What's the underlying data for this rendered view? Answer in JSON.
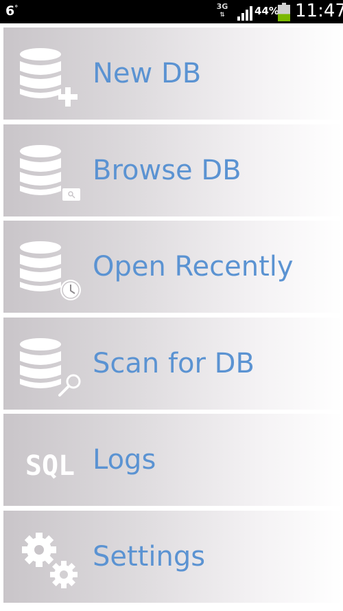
{
  "status_bar": {
    "notification": "6",
    "notification_sup": "°",
    "network": "3G",
    "battery_percent": "44%",
    "battery_level": 0.44,
    "time": "11:47"
  },
  "menu": {
    "items": [
      {
        "label": "New DB",
        "icon": "database-add-icon"
      },
      {
        "label": "Browse DB",
        "icon": "database-browse-icon"
      },
      {
        "label": "Open Recently",
        "icon": "database-recent-icon"
      },
      {
        "label": "Scan for DB",
        "icon": "database-scan-icon"
      },
      {
        "label": "Logs",
        "icon": "sql-icon",
        "icon_text": "SQL"
      },
      {
        "label": "Settings",
        "icon": "gears-icon"
      }
    ]
  },
  "colors": {
    "label": "#5b93d2",
    "icon": "#ffffff",
    "statusbar": "#000000",
    "battery": "#7ab800"
  }
}
